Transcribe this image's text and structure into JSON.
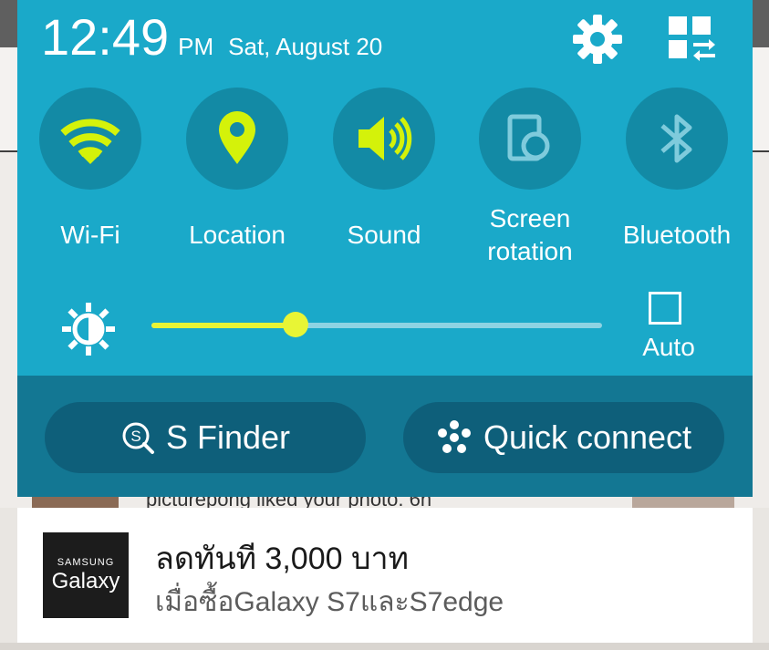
{
  "background_app": {
    "feed_text": "picturepong liked your photo. 6h"
  },
  "status": {
    "time": "12:49",
    "ampm": "PM",
    "date": "Sat, August 20"
  },
  "header_icons": {
    "settings": "gear-icon",
    "edit": "grid-edit-icon"
  },
  "quick_toggles": [
    {
      "label": "Wi-Fi",
      "icon": "wifi-icon",
      "active": true
    },
    {
      "label": "Location",
      "icon": "location-icon",
      "active": true
    },
    {
      "label": "Sound",
      "icon": "sound-icon",
      "active": true
    },
    {
      "label": "Screen rotation",
      "label_line1": "Screen",
      "label_line2": "rotation",
      "icon": "rotation-icon",
      "active": false
    },
    {
      "label": "Bluetooth",
      "icon": "bluetooth-icon",
      "active": false
    }
  ],
  "brightness": {
    "level": 0.32,
    "auto_label": "Auto",
    "auto_checked": false
  },
  "actions": {
    "s_finder": "S Finder",
    "quick_connect": "Quick connect"
  },
  "notification": {
    "logo_small": "SAMSUNG",
    "logo_big": "Galaxy",
    "title": "ลดทันที 3,000 บาท",
    "text": "เมื่อซื้อGalaxy S7และS7edge"
  },
  "colors": {
    "panel": "#1aa9c9",
    "toggle_bg": "#138aa5",
    "active": "#d4f20a",
    "inactive": "#7fcbdc",
    "bottom_bar": "#137793",
    "pill": "#0e5f7a"
  }
}
